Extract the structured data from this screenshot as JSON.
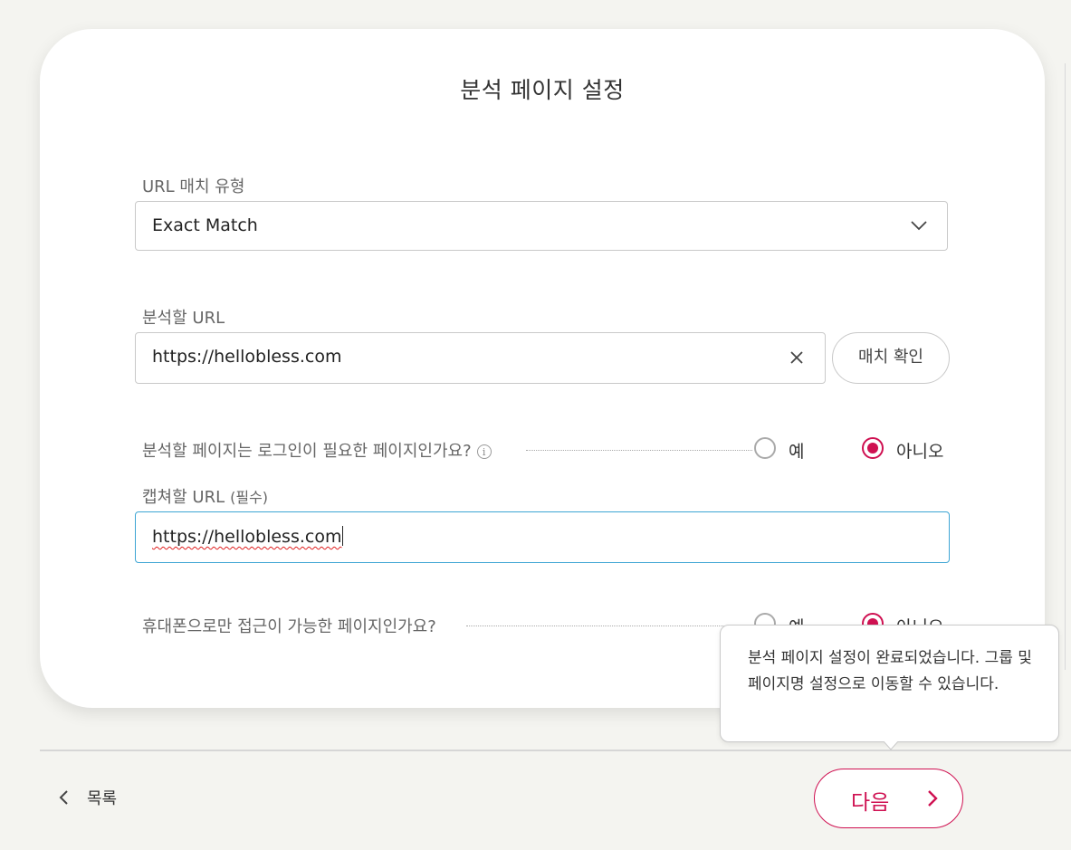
{
  "card": {
    "title": "분석 페이지 설정"
  },
  "match_type": {
    "label": "URL 매치 유형",
    "selected": "Exact Match"
  },
  "analyze_url": {
    "label": "분석할 URL",
    "value": "https://hellobless.com",
    "check_button": "매치 확인"
  },
  "login_question": {
    "text": "분석할 페이지는 로그인이 필요한 페이지인가요?",
    "options": [
      "예",
      "아니오"
    ],
    "selected": "아니오"
  },
  "capture_url": {
    "label": "캡쳐할 URL",
    "required": "(필수)",
    "value": "https://hellobless.com"
  },
  "mobile_question": {
    "text": "휴대폰으로만 접근이 가능한 페이지인가요?",
    "options": [
      "예",
      "아니오"
    ],
    "selected": "아니오"
  },
  "tooltip": {
    "text": "분석 페이지 설정이 완료되었습니다. 그룹 및 페이지명 설정으로 이동할 수 있습니다."
  },
  "footer": {
    "back_label": "목록",
    "next_label": "다음"
  },
  "colors": {
    "accent": "#cf1051",
    "focus": "#3da5d4",
    "background": "#f4f4f0"
  },
  "icons": {
    "dropdown": "chevron-down-icon",
    "clear": "close-icon",
    "info": "info-icon",
    "back": "chevron-left-icon",
    "next": "chevron-right-icon"
  }
}
